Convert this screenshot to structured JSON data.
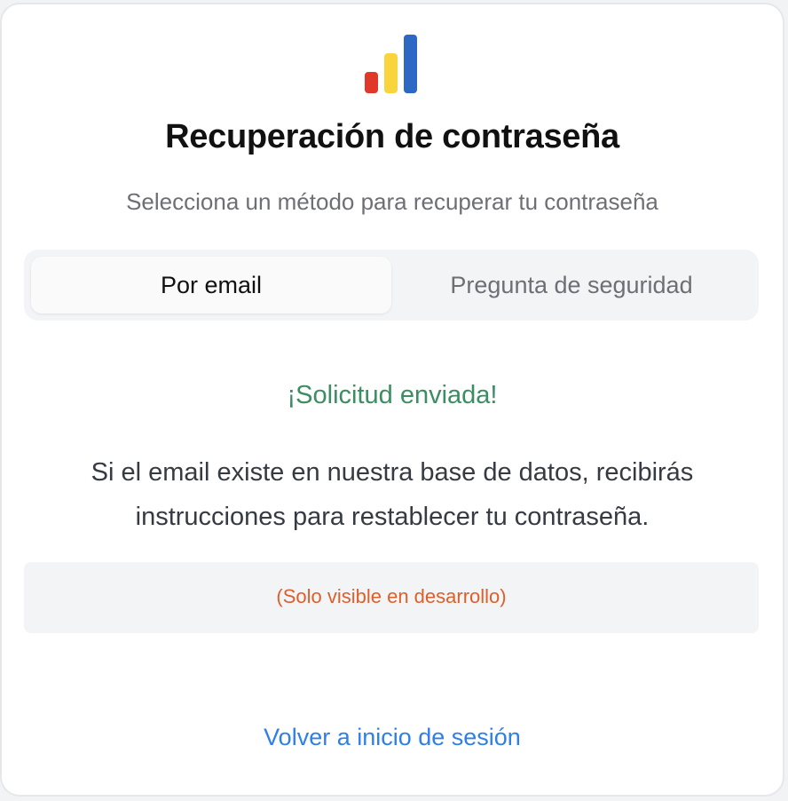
{
  "logo": {
    "icon": "bar-chart-logo-icon",
    "colors": [
      "#e0382b",
      "#f8d53d",
      "#2c68c4"
    ]
  },
  "title": "Recuperación de contraseña",
  "subtitle": "Selecciona un método para recuperar tu contraseña",
  "tabs": [
    {
      "label": "Por email",
      "active": true
    },
    {
      "label": "Pregunta de seguridad",
      "active": false
    }
  ],
  "success": {
    "heading": "¡Solicitud enviada!",
    "message": "Si el email existe en nuestra base de datos, recibirás instrucciones para restablecer tu contraseña."
  },
  "dev_note": "(Solo visible en desarrollo)",
  "back_link": "Volver a inicio de sesión",
  "colors": {
    "success": "#3c8d62",
    "dev_note": "#dd5f2b",
    "link": "#2f7fe8"
  }
}
